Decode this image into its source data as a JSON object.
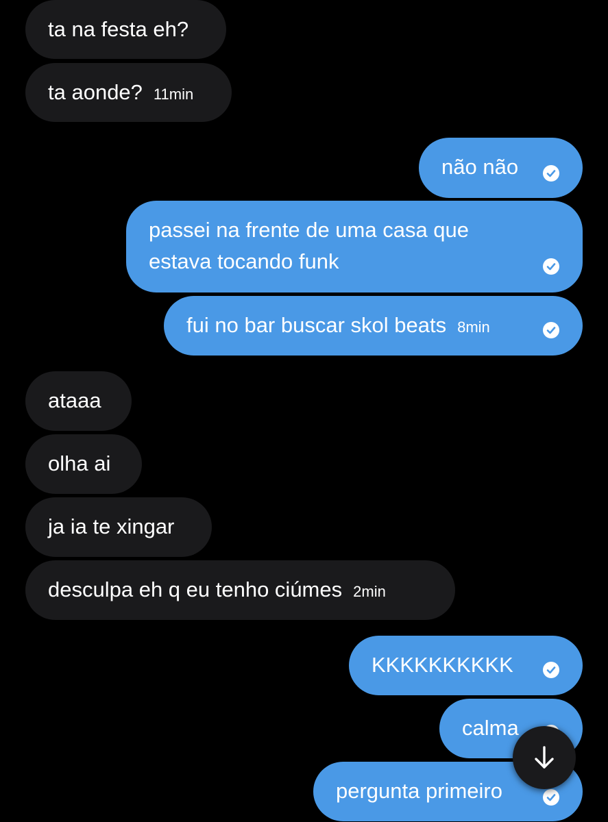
{
  "colors": {
    "background": "#000000",
    "incoming_bubble": "#1a1a1c",
    "outgoing_bubble": "#4a99e6",
    "text": "#ffffff",
    "check_icon": "#ffffff"
  },
  "messages": [
    {
      "direction": "incoming",
      "text": "ta na festa eh?",
      "time": ""
    },
    {
      "direction": "incoming",
      "text": "ta aonde?",
      "time": "11min"
    },
    {
      "direction": "outgoing",
      "text": "não não",
      "time": "",
      "read_icon": "check-circle-icon"
    },
    {
      "direction": "outgoing",
      "text_line1": "passei na frente de uma casa que",
      "text_line2": "estava tocando funk",
      "time": "",
      "read_icon": "check-circle-icon"
    },
    {
      "direction": "outgoing",
      "text": "fui no bar buscar skol beats",
      "time": "8min",
      "read_icon": "check-circle-icon"
    },
    {
      "direction": "incoming",
      "text": "ataaa",
      "time": ""
    },
    {
      "direction": "incoming",
      "text": "olha ai",
      "time": ""
    },
    {
      "direction": "incoming",
      "text": "ja ia te xingar",
      "time": ""
    },
    {
      "direction": "incoming",
      "text": "desculpa eh q eu tenho ciúmes",
      "time": "2min"
    },
    {
      "direction": "outgoing",
      "text": "KKKKKKKKKK",
      "time": "",
      "read_icon": "check-circle-icon"
    },
    {
      "direction": "outgoing",
      "text": "calma",
      "time": "",
      "read_icon": "check-circle-icon"
    },
    {
      "direction": "outgoing",
      "text": "pergunta primeiro",
      "time": "",
      "read_icon": "check-circle-icon"
    }
  ],
  "scroll_button": {
    "icon": "arrow-down-icon"
  }
}
